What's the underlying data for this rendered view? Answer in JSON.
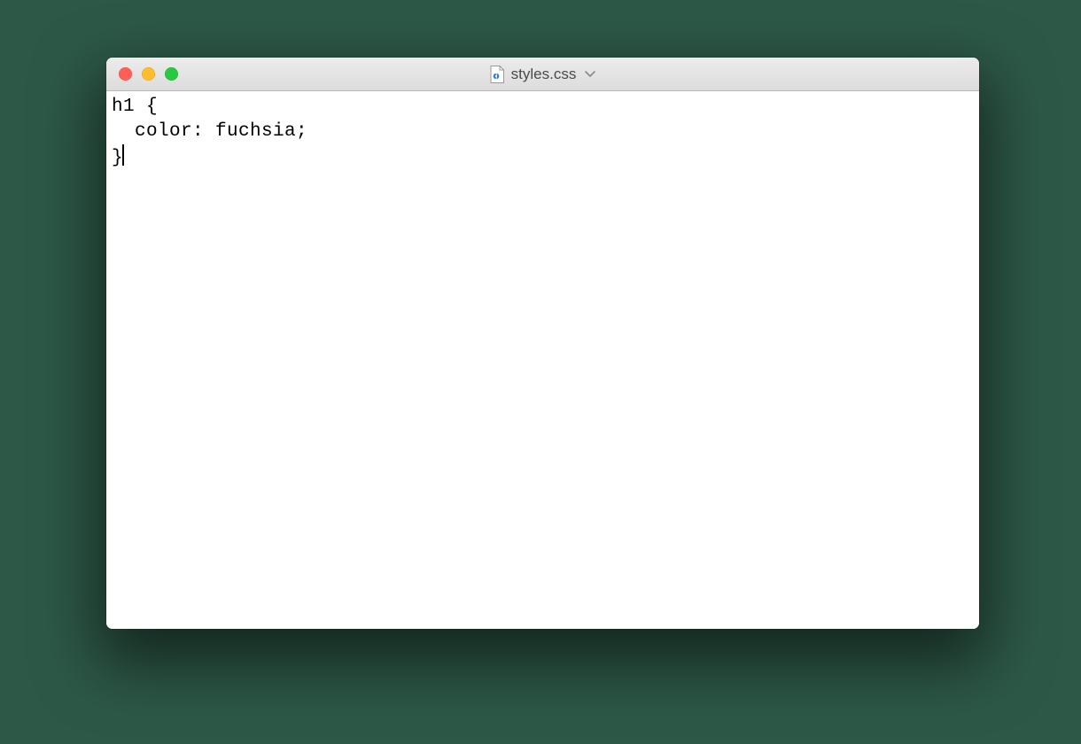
{
  "window": {
    "filename": "styles.css",
    "traffic_lights": {
      "close": "close",
      "minimize": "minimize",
      "zoom": "zoom"
    }
  },
  "editor": {
    "lines": {
      "l1": "h1 {",
      "l2": "  color: fuchsia;",
      "l3": "}"
    }
  }
}
